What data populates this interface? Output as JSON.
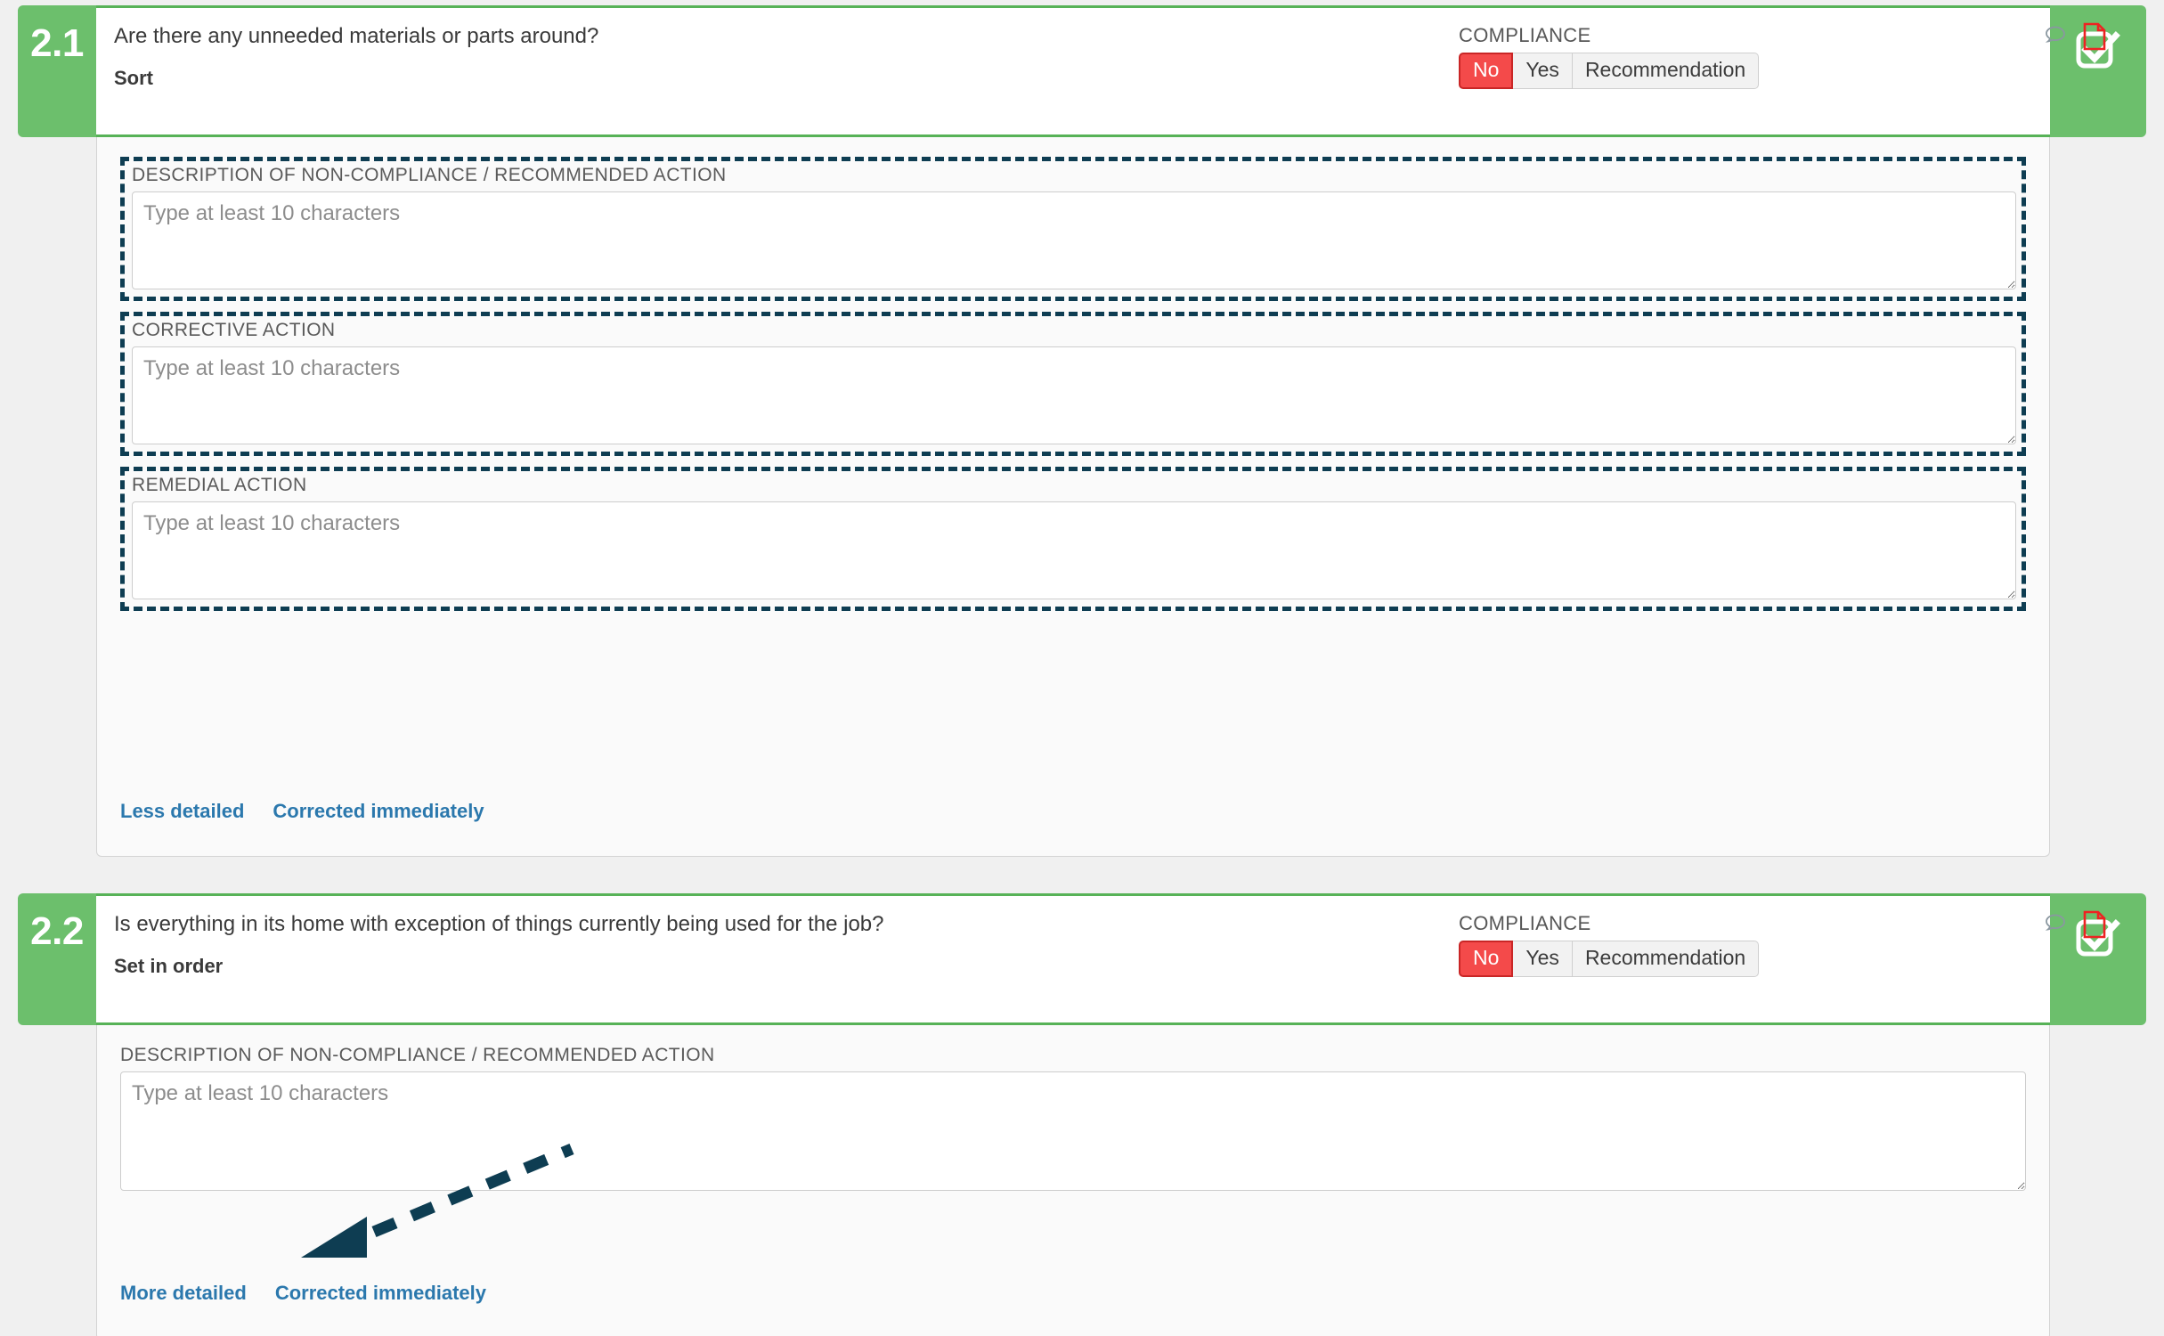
{
  "theme": {
    "green": "#6cbf6c",
    "green_border": "#57b257",
    "red": "#f44a4a",
    "red_border": "#c92626",
    "link_blue": "#2b78ad",
    "annotation_navy": "#0e3d52",
    "page_bg": "#f0f0f0",
    "panel_bg": "#fafafa"
  },
  "questions": [
    {
      "number": "2.1",
      "text": "Are there any unneeded materials or parts around?",
      "subtitle": "Sort",
      "compliance": {
        "label": "COMPLIANCE",
        "options": [
          "No",
          "Yes",
          "Recommendation"
        ],
        "selected": "No"
      },
      "icons": {
        "comment": "comment-bubble-icon",
        "document": "document-icon",
        "check": "checkbox-checked-icon"
      },
      "fields": [
        {
          "label": "DESCRIPTION OF NON-COMPLIANCE / RECOMMENDED ACTION",
          "placeholder": "Type at least 10 characters",
          "value": "",
          "highlighted": true
        },
        {
          "label": "CORRECTIVE ACTION",
          "placeholder": "Type at least 10 characters",
          "value": "",
          "highlighted": true
        },
        {
          "label": "REMEDIAL ACTION",
          "placeholder": "Type at least 10 characters",
          "value": "",
          "highlighted": true
        }
      ],
      "links": [
        "Less detailed",
        "Corrected immediately"
      ]
    },
    {
      "number": "2.2",
      "text": "Is everything in its home with exception of things currently being used for the job?",
      "subtitle": "Set in order",
      "compliance": {
        "label": "COMPLIANCE",
        "options": [
          "No",
          "Yes",
          "Recommendation"
        ],
        "selected": "No"
      },
      "icons": {
        "comment": "comment-bubble-icon",
        "document": "document-icon",
        "check": "checkbox-checked-icon"
      },
      "fields": [
        {
          "label": "DESCRIPTION OF NON-COMPLIANCE / RECOMMENDED ACTION",
          "placeholder": "Type at least 10 characters",
          "value": "",
          "highlighted": false
        }
      ],
      "links": [
        "More detailed",
        "Corrected immediately"
      ]
    }
  ],
  "annotation": {
    "type": "dashed-arrow",
    "points_to": "More detailed",
    "color": "#0e3d52"
  }
}
